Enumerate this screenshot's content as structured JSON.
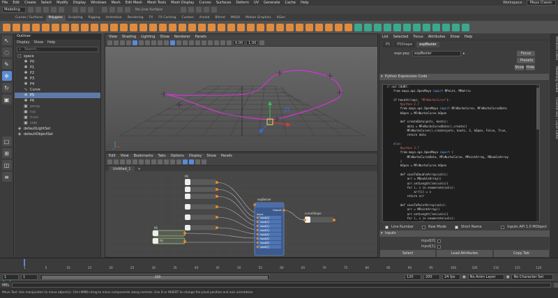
{
  "menubar": {
    "items": [
      "File",
      "Edit",
      "Create",
      "Select",
      "Modify",
      "Display",
      "Windows",
      "Mesh",
      "Edit Mesh",
      "Mesh Tools",
      "Mesh Display",
      "Curves",
      "Surfaces",
      "Deform",
      "UV",
      "Generate",
      "Cache",
      "Help"
    ],
    "workspace_label": "Workspace :",
    "workspace_value": "Maya Classic"
  },
  "statusline": {
    "mode": "Modeling",
    "live_surface": "No Live Surface"
  },
  "shelf": {
    "tabs": [
      "Curves / Surfaces",
      "Polygons",
      "Sculpting",
      "Rigging",
      "Animation",
      "Rendering",
      "FX",
      "FX Caching",
      "Custom",
      "Arnold",
      "Bifrost",
      "MASH",
      "Motion Graphics",
      "XGen"
    ],
    "active_tab": "Polygons",
    "icon_colors": [
      "#e08a3c",
      "#e08a3c",
      "#e08a3c",
      "#e08a3c",
      "#e08a3c",
      "#e08a3c",
      "#e08a3c",
      "#e08a3c",
      "#e08a3c",
      "#e08a3c",
      "#e08a3c",
      "#e08a3c",
      "#e08a3c",
      "#e08a3c",
      "#e08a3c",
      "#e08a3c",
      "#e08a3c",
      "#e08a3c",
      "#e08a3c",
      "#e08a3c",
      "#e08a3c",
      "#e08a3c",
      "#e08a3c",
      "#e08a3c",
      "#e08a3c",
      "#e08a3c",
      "#e08a3c",
      "#e08a3c",
      "#e08a3c",
      "#e08a3c",
      "#e08a3c",
      "#e08a3c",
      "#e08a3c",
      "#e08a3c",
      "#e08a3c",
      "#e08a3c",
      "#3aa88e",
      "#3aa88e",
      "#3aa88e",
      "#3aa88e",
      "#3aa88e",
      "#3aa88e",
      "#3aa88e",
      "#3aa88e",
      "#3aa88e",
      "#3aa88e",
      "#3aa88e",
      "#3aa88e"
    ]
  },
  "outliner": {
    "title": "Outliner",
    "menu": [
      "Display",
      "Show",
      "Help"
    ],
    "search_placeholder": "Search...",
    "items": [
      {
        "label": "space",
        "indent": 0,
        "icon": "group-icon",
        "state": "normal"
      },
      {
        "label": "P0",
        "indent": 1,
        "icon": "locator-icon",
        "state": "normal"
      },
      {
        "label": "P1",
        "indent": 1,
        "icon": "locator-icon",
        "state": "normal"
      },
      {
        "label": "P2",
        "indent": 1,
        "icon": "locator-icon",
        "state": "normal"
      },
      {
        "label": "P3",
        "indent": 1,
        "icon": "locator-icon",
        "state": "normal"
      },
      {
        "label": "P4",
        "indent": 1,
        "icon": "locator-icon",
        "state": "normal"
      },
      {
        "label": "Curve",
        "indent": 1,
        "icon": "curve-icon",
        "state": "normal"
      },
      {
        "label": "P5",
        "indent": 1,
        "icon": "locator-icon",
        "state": "selected"
      },
      {
        "label": "P6",
        "indent": 1,
        "icon": "locator-icon",
        "state": "normal"
      },
      {
        "label": "persp",
        "indent": 1,
        "icon": "camera-icon",
        "state": "dim"
      },
      {
        "label": "top",
        "indent": 1,
        "icon": "camera-icon",
        "state": "dim"
      },
      {
        "label": "front",
        "indent": 1,
        "icon": "camera-icon",
        "state": "dim"
      },
      {
        "label": "side",
        "indent": 1,
        "icon": "camera-icon",
        "state": "dim"
      },
      {
        "label": "defaultLightSet",
        "indent": 0,
        "icon": "set-icon",
        "state": "normal"
      },
      {
        "label": "defaultObjectSet",
        "indent": 0,
        "icon": "set-icon",
        "state": "normal"
      }
    ]
  },
  "viewport": {
    "menu": [
      "View",
      "Shading",
      "Lighting",
      "Show",
      "Renderer",
      "Panels"
    ],
    "field_a": "0.00",
    "field_b": "1.00"
  },
  "node_editor": {
    "menu": [
      "Edit",
      "View",
      "Bookmarks",
      "Tabs",
      "Options",
      "Display",
      "Show",
      "Panels"
    ],
    "tab": "Untitled_1",
    "main_node": "expBezier",
    "main_node_output": "Output",
    "main_node_input": "input",
    "main_node_inputs": [
      "input[0]",
      "input[1]",
      "input[2]",
      "input[3]",
      "input[4]",
      "input[5]",
      "input[6]",
      "input[7]"
    ],
    "shape_node": "curveShape",
    "source_top": "P0",
    "source_left": "P6",
    "source_left2": "P5"
  },
  "attribute_editor": {
    "menu": [
      "List",
      "Selected",
      "Focus",
      "Attributes",
      "Show",
      "Help"
    ],
    "tabs": [
      "P5",
      "P5Shape",
      "expBezier"
    ],
    "active_tab": "expBezier",
    "node_label": "expr.pay:",
    "node_value": "expBezier",
    "focus_btn": "Focus",
    "presets_btn": "Presets",
    "show_btn": "Show",
    "hide_btn": "Hide",
    "section_expr": "Python Expression Code",
    "code_lines": [
      [
        {
          "t": "if ",
          "c": "kw"
        },
        {
          "t": "not COUNT:",
          "c": ""
        }
      ],
      [
        {
          "t": "    from maya.api.OpenMaya ",
          "c": ""
        },
        {
          "t": "import",
          "c": "kw"
        },
        {
          "t": " MPoint, MMatrix",
          "c": ""
        }
      ],
      [
        {
          "t": "",
          "c": ""
        }
      ],
      [
        {
          "t": "    if hasattr(api, ",
          "c": ""
        },
        {
          "t": "\"MFnNurbsCurve\"",
          "c": "str"
        },
        {
          "t": "):",
          "c": ""
        }
      ],
      [
        {
          "t": "        ",
          "c": ""
        },
        {
          "t": "#python 2.7",
          "c": "cm"
        }
      ],
      [
        {
          "t": "        from maya.api.OpenMaya ",
          "c": ""
        },
        {
          "t": "import",
          "c": "kw"
        },
        {
          "t": " MFnNurbsCurve, MFnNurbsCurveData",
          "c": ""
        }
      ],
      [
        {
          "t": "        kOpen = MFnNurbsCurve.kOpen",
          "c": ""
        }
      ],
      [
        {
          "t": "",
          "c": ""
        }
      ],
      [
        {
          "t": "        def createData(pnts, knots):",
          "c": ""
        }
      ],
      [
        {
          "t": "            data = MFnNurbsCurveData().create()",
          "c": ""
        }
      ],
      [
        {
          "t": "            MFnNurbsCurve().create(pnts, knots, 3, kOpen, False, True,",
          "c": ""
        }
      ],
      [
        {
          "t": "            return data",
          "c": ""
        }
      ],
      [
        {
          "t": "",
          "c": ""
        }
      ],
      [
        {
          "t": "    else:",
          "c": "kw"
        }
      ],
      [
        {
          "t": "        ",
          "c": ""
        },
        {
          "t": "#python 3.7",
          "c": "cm"
        }
      ],
      [
        {
          "t": "        from maya.api.OpenMaya ",
          "c": ""
        },
        {
          "t": "import",
          "c": "kw"
        },
        {
          "t": " (",
          "c": ""
        }
      ],
      [
        {
          "t": "            MFnNurbsCurveData, MFnNurbsCurve, MPointArray, MDoubleArray",
          "c": ""
        }
      ],
      [
        {
          "t": "        )",
          "c": ""
        }
      ],
      [
        {
          "t": "        kOpen = MFnNurbsCurve.kOpen",
          "c": ""
        }
      ],
      [
        {
          "t": "",
          "c": ""
        }
      ],
      [
        {
          "t": "        def convToDoubleArray(vals):",
          "c": ""
        }
      ],
      [
        {
          "t": "            arr = MDoubleArray()",
          "c": ""
        }
      ],
      [
        {
          "t": "            arr.setLength(len(vals))",
          "c": ""
        }
      ],
      [
        {
          "t": "            for i, v in enumerate(vals):",
          "c": ""
        }
      ],
      [
        {
          "t": "                arr[i] = v",
          "c": ""
        }
      ],
      [
        {
          "t": "            return arr",
          "c": ""
        }
      ],
      [
        {
          "t": "",
          "c": ""
        }
      ],
      [
        {
          "t": "        def convToPointArray(vals):",
          "c": ""
        }
      ],
      [
        {
          "t": "            arr = MPointArray()",
          "c": ""
        }
      ],
      [
        {
          "t": "            arr.setLength(len(vals))",
          "c": ""
        }
      ],
      [
        {
          "t": "            for i, v in enumerate(vals):",
          "c": ""
        }
      ],
      [
        {
          "t": "                arr[i] = v",
          "c": ""
        }
      ]
    ],
    "opt_line_number": "Line Number",
    "opt_raw_mode": "Raw Mode",
    "opt_short_name": "Short Name",
    "opt_inputs_api": "Inputs API 1.0 MObject",
    "section_inputs": "Inputs",
    "input0_label": "input[0]",
    "input1_label": "input[1]",
    "btn_select": "Select",
    "btn_load": "Load Attributes",
    "btn_copy": "Copy Tab"
  },
  "side_tabs": [
    "Attribute Editor",
    "Modelling Toolkit",
    "Channel Box / Layer Editor"
  ],
  "timeline": {
    "ticks": [
      "1",
      "5",
      "10",
      "15",
      "20",
      "25",
      "30",
      "35",
      "40",
      "45",
      "50",
      "55",
      "60",
      "65",
      "70",
      "75",
      "80",
      "85",
      "90",
      "95",
      "100",
      "105",
      "110",
      "115",
      "120"
    ],
    "current_frame": "1"
  },
  "range": {
    "start": "1",
    "start_inner": "1",
    "end_inner": "120",
    "slider_label": "120",
    "end": "120",
    "end_outer": "200",
    "fps": "24 fps",
    "anim_layer": "No Anim Layer",
    "char_set": "No Character Set"
  },
  "cmdline": {
    "language": "MEL"
  },
  "helpline": {
    "text": "Move Tool: Use manipulator to move object(s). Ctrl+MMB+drag to move components along normals. Use D or INSERT to change the pivot position and axis orientation."
  }
}
